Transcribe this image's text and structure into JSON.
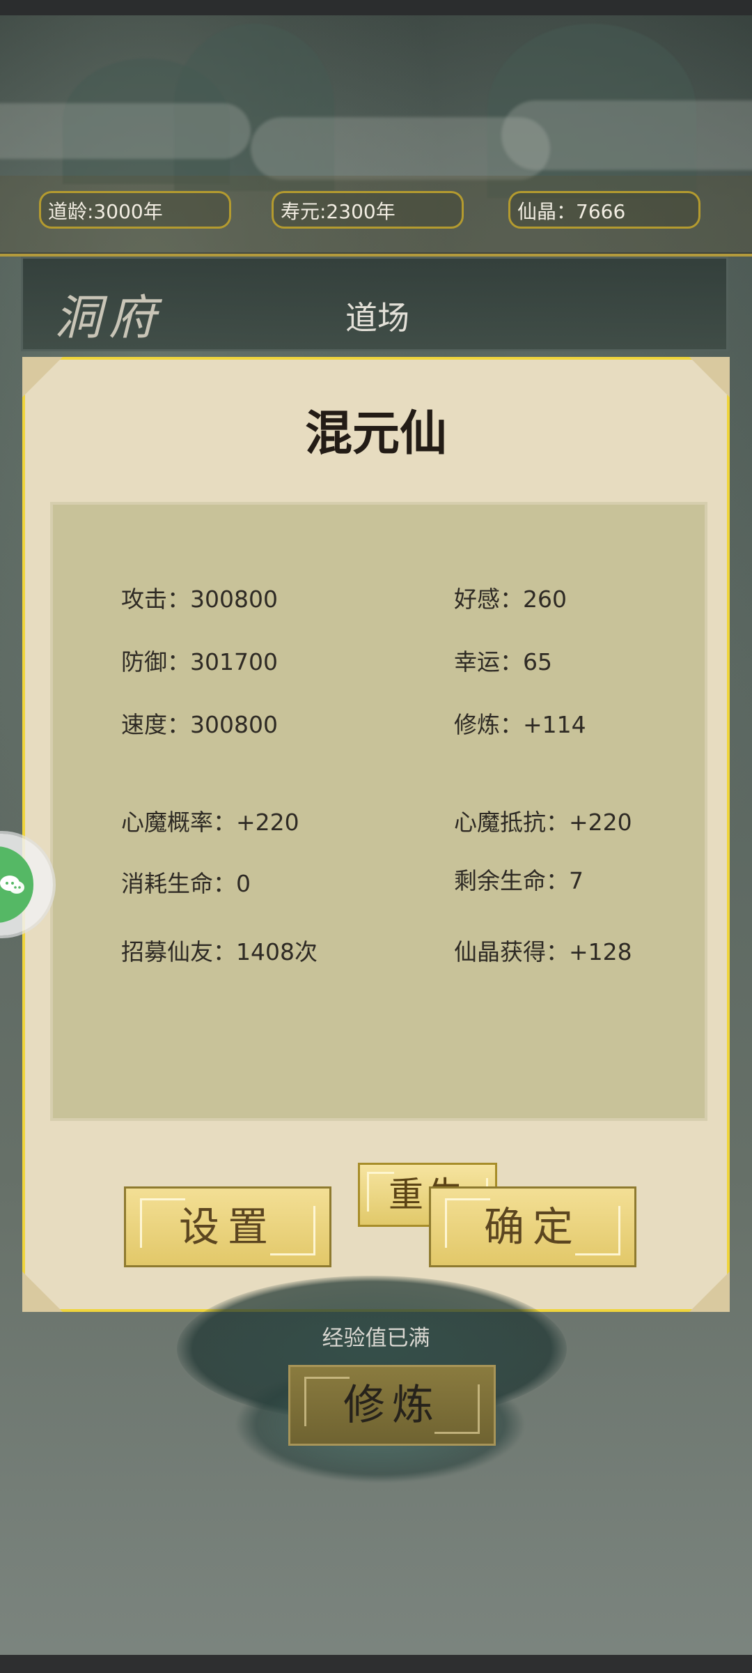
{
  "stats": {
    "dao_age": "道龄:3000年",
    "lifespan": "寿元:2300年",
    "crystal": "仙晶：7666"
  },
  "header": {
    "cave": "洞府",
    "dojo": "道场"
  },
  "modal": {
    "title": "混元仙",
    "rebirth": "重生",
    "settings": "设置",
    "confirm": "确定",
    "items": [
      "攻击：300800",
      "好感：260",
      "防御：301700",
      "幸运：65",
      "速度：300800",
      "修炼：+114",
      "心魔概率：+220",
      "心魔抵抗：+220",
      "消耗生命：0",
      "剩余生命：7",
      "招募仙友：1408次",
      "仙晶获得：+128"
    ]
  },
  "footer": {
    "exp_status": "经验值已满",
    "cultivate": "修炼"
  },
  "icons": {
    "chat": "chat-bubble-icon"
  },
  "colors": {
    "accent": "#f0d53c",
    "panel": "#e7dcc0",
    "stats_box": "#c8c299",
    "button": "#e2c869",
    "chat": "#55b865"
  }
}
